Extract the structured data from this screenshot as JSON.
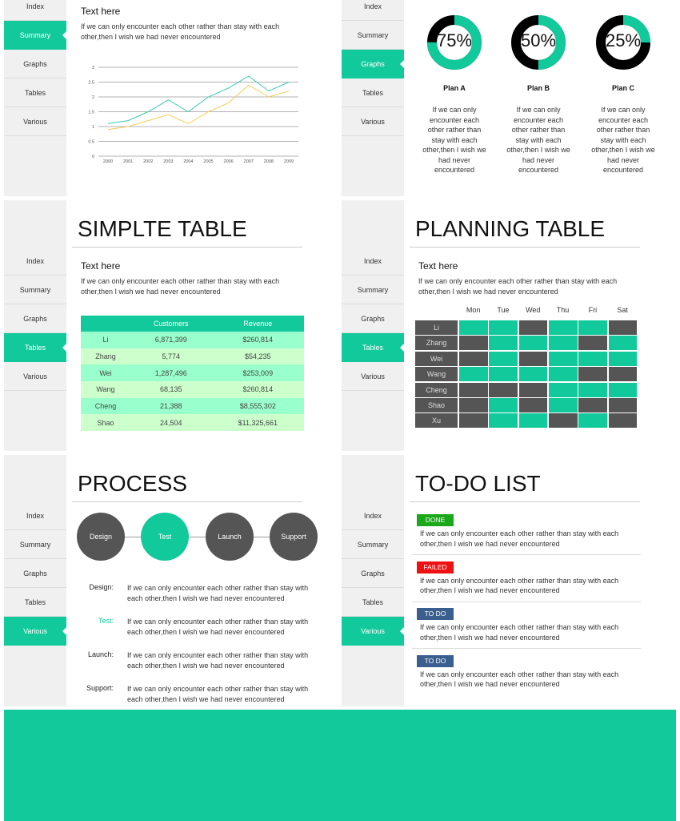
{
  "colors": {
    "accent": "#12c99b",
    "dark": "#555555",
    "yellow": "#f5cd5a",
    "teal_line": "#3cc9b0",
    "done": "#1aa81a",
    "failed": "#ee1111",
    "todo": "#3a5f8f"
  },
  "nav": [
    "Index",
    "Summary",
    "Graphs",
    "Tables",
    "Various"
  ],
  "body_text": "If we can only encounter each other rather than stay with each other,then I wish we had never encountered",
  "summary": {
    "active": "Summary",
    "heading": "Text here",
    "chart_data": {
      "type": "line",
      "x": [
        "2000",
        "2001",
        "2002",
        "2003",
        "2004",
        "2005",
        "2006",
        "2007",
        "2008",
        "2009"
      ],
      "ylim": [
        0,
        3
      ],
      "yticks": [
        "0",
        "0.5",
        "1",
        "1.5",
        "2",
        "2.5",
        "3"
      ],
      "grid": true,
      "series": [
        {
          "color": "#3cc9b0",
          "values": [
            1.1,
            1.2,
            1.5,
            1.9,
            1.5,
            2.0,
            2.3,
            2.7,
            2.2,
            2.5
          ]
        },
        {
          "color": "#f5cd5a",
          "values": [
            0.9,
            1.0,
            1.2,
            1.4,
            1.1,
            1.5,
            1.8,
            2.4,
            2.0,
            2.2
          ]
        }
      ]
    }
  },
  "graphs": {
    "active": "Graphs",
    "plans": [
      {
        "name": "Plan A",
        "percent": 75,
        "label": "75%"
      },
      {
        "name": "Plan B",
        "percent": 50,
        "label": "50%"
      },
      {
        "name": "Plan C",
        "percent": 25,
        "label": "25%"
      }
    ],
    "plan_text": "If we can only encounter each other rather than stay with each other,then I wish we had never encountered"
  },
  "simple_table": {
    "active": "Tables",
    "title": "SIMPLTE TABLE",
    "heading": "Text here",
    "columns": [
      "",
      "Customers",
      "Revenue"
    ],
    "rows": [
      [
        "Li",
        "6,871,399",
        "$260,814"
      ],
      [
        "Zhang",
        "5,774",
        "$54,235"
      ],
      [
        "Wei",
        "1,287,496",
        "$253,009"
      ],
      [
        "Wang",
        "68,135",
        "$260,814"
      ],
      [
        "Cheng",
        "21,388",
        "$8,555,302"
      ],
      [
        "Shao",
        "24,504",
        "$11,325,661"
      ]
    ]
  },
  "planning_table": {
    "active": "Tables",
    "title": "PLANNING TABLE",
    "heading": "Text here",
    "days": [
      "Mon",
      "Tue",
      "Wed",
      "Thu",
      "Fri",
      "Sat"
    ],
    "rows": [
      {
        "name": "Li",
        "plan": [
          1,
          1,
          0,
          1,
          1,
          0
        ]
      },
      {
        "name": "Zhang",
        "plan": [
          0,
          1,
          1,
          1,
          0,
          1
        ]
      },
      {
        "name": "Wei",
        "plan": [
          0,
          1,
          0,
          1,
          1,
          1
        ]
      },
      {
        "name": "Wang",
        "plan": [
          1,
          1,
          1,
          1,
          0,
          0
        ]
      },
      {
        "name": "Cheng",
        "plan": [
          0,
          0,
          0,
          1,
          1,
          1
        ]
      },
      {
        "name": "Shao",
        "plan": [
          0,
          1,
          0,
          1,
          0,
          0
        ]
      },
      {
        "name": "Xu",
        "plan": [
          0,
          1,
          1,
          0,
          1,
          0
        ]
      }
    ]
  },
  "process": {
    "active": "Various",
    "title": "PROCESS",
    "steps": [
      "Design",
      "Test",
      "Launch",
      "Support"
    ],
    "highlight": "Test",
    "details": [
      {
        "label": "Design:",
        "text": "If we can only encounter each other rather than stay with each other,then I wish we had never encountered"
      },
      {
        "label": "Test:",
        "text": "If we can only encounter each other rather than stay with each other,then I wish we had never encountered"
      },
      {
        "label": "Launch:",
        "text": "If we can only encounter each other rather than stay with each other,then I wish we had never encountered"
      },
      {
        "label": "Support:",
        "text": "If we can only encounter each other rather than stay with each other,then I wish we had never encountered"
      }
    ]
  },
  "todo": {
    "active": "Various",
    "title": "TO-DO LIST",
    "items": [
      {
        "status": "DONE",
        "color": "#1aa81a"
      },
      {
        "status": "FAILED",
        "color": "#ee1111"
      },
      {
        "status": "TO DO",
        "color": "#3a5f8f"
      },
      {
        "status": "TO DO",
        "color": "#3a5f8f"
      }
    ]
  }
}
